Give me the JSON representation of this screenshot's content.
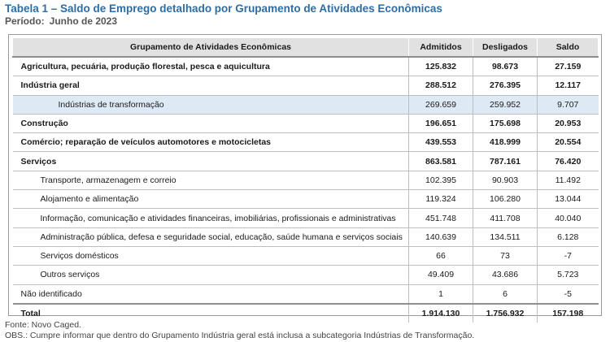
{
  "title": "Tabela 1 – Saldo de Emprego detalhado por Grupamento de Atividades Econômicas",
  "period": {
    "label": "Período:",
    "value": "Junho de 2023"
  },
  "table": {
    "headers": [
      "Grupamento de Atividades Econômicas",
      "Admitidos",
      "Desligados",
      "Saldo"
    ],
    "rows": [
      {
        "label": "Agricultura, pecuária, produção florestal, pesca e aquicultura",
        "admitidos": "125.832",
        "desligados": "98.673",
        "saldo": "27.159",
        "level": 0,
        "bold": true
      },
      {
        "label": "Indústria geral",
        "admitidos": "288.512",
        "desligados": "276.395",
        "saldo": "12.117",
        "level": 0,
        "bold": true
      },
      {
        "label": "Indústrias de transformação",
        "admitidos": "269.659",
        "desligados": "259.952",
        "saldo": "9.707",
        "level": 2,
        "bold": false,
        "highlight": true
      },
      {
        "label": "Construção",
        "admitidos": "196.651",
        "desligados": "175.698",
        "saldo": "20.953",
        "level": 0,
        "bold": true
      },
      {
        "label": "Comércio; reparação de veículos automotores e motocicletas",
        "admitidos": "439.553",
        "desligados": "418.999",
        "saldo": "20.554",
        "level": 0,
        "bold": true
      },
      {
        "label": "Serviços",
        "admitidos": "863.581",
        "desligados": "787.161",
        "saldo": "76.420",
        "level": 0,
        "bold": true
      },
      {
        "label": "Transporte, armazenagem e correio",
        "admitidos": "102.395",
        "desligados": "90.903",
        "saldo": "11.492",
        "level": 1,
        "bold": false
      },
      {
        "label": "Alojamento e alimentação",
        "admitidos": "119.324",
        "desligados": "106.280",
        "saldo": "13.044",
        "level": 1,
        "bold": false
      },
      {
        "label": "Informação, comunicação e atividades financeiras, imobiliárias, profissionais e administrativas",
        "admitidos": "451.748",
        "desligados": "411.708",
        "saldo": "40.040",
        "level": 1,
        "bold": false
      },
      {
        "label": "Administração pública, defesa e seguridade social, educação, saúde humana e serviços sociais",
        "admitidos": "140.639",
        "desligados": "134.511",
        "saldo": "6.128",
        "level": 1,
        "bold": false
      },
      {
        "label": "Serviços domésticos",
        "admitidos": "66",
        "desligados": "73",
        "saldo": "-7",
        "level": 1,
        "bold": false
      },
      {
        "label": "Outros serviços",
        "admitidos": "49.409",
        "desligados": "43.686",
        "saldo": "5.723",
        "level": 1,
        "bold": false
      },
      {
        "label": "Não identificado",
        "admitidos": "1",
        "desligados": "6",
        "saldo": "-5",
        "level": 0,
        "bold": false
      },
      {
        "label": "Total",
        "admitidos": "1.914.130",
        "desligados": "1.756.932",
        "saldo": "157.198",
        "level": 0,
        "bold": true,
        "total": true
      }
    ]
  },
  "notes": {
    "source": "Fonte: Novo Caged.",
    "obs": "OBS.: Cumpre informar que dentro do Grupamento Indústria geral está inclusa a subcategoria Indústrias de Transformação."
  }
}
